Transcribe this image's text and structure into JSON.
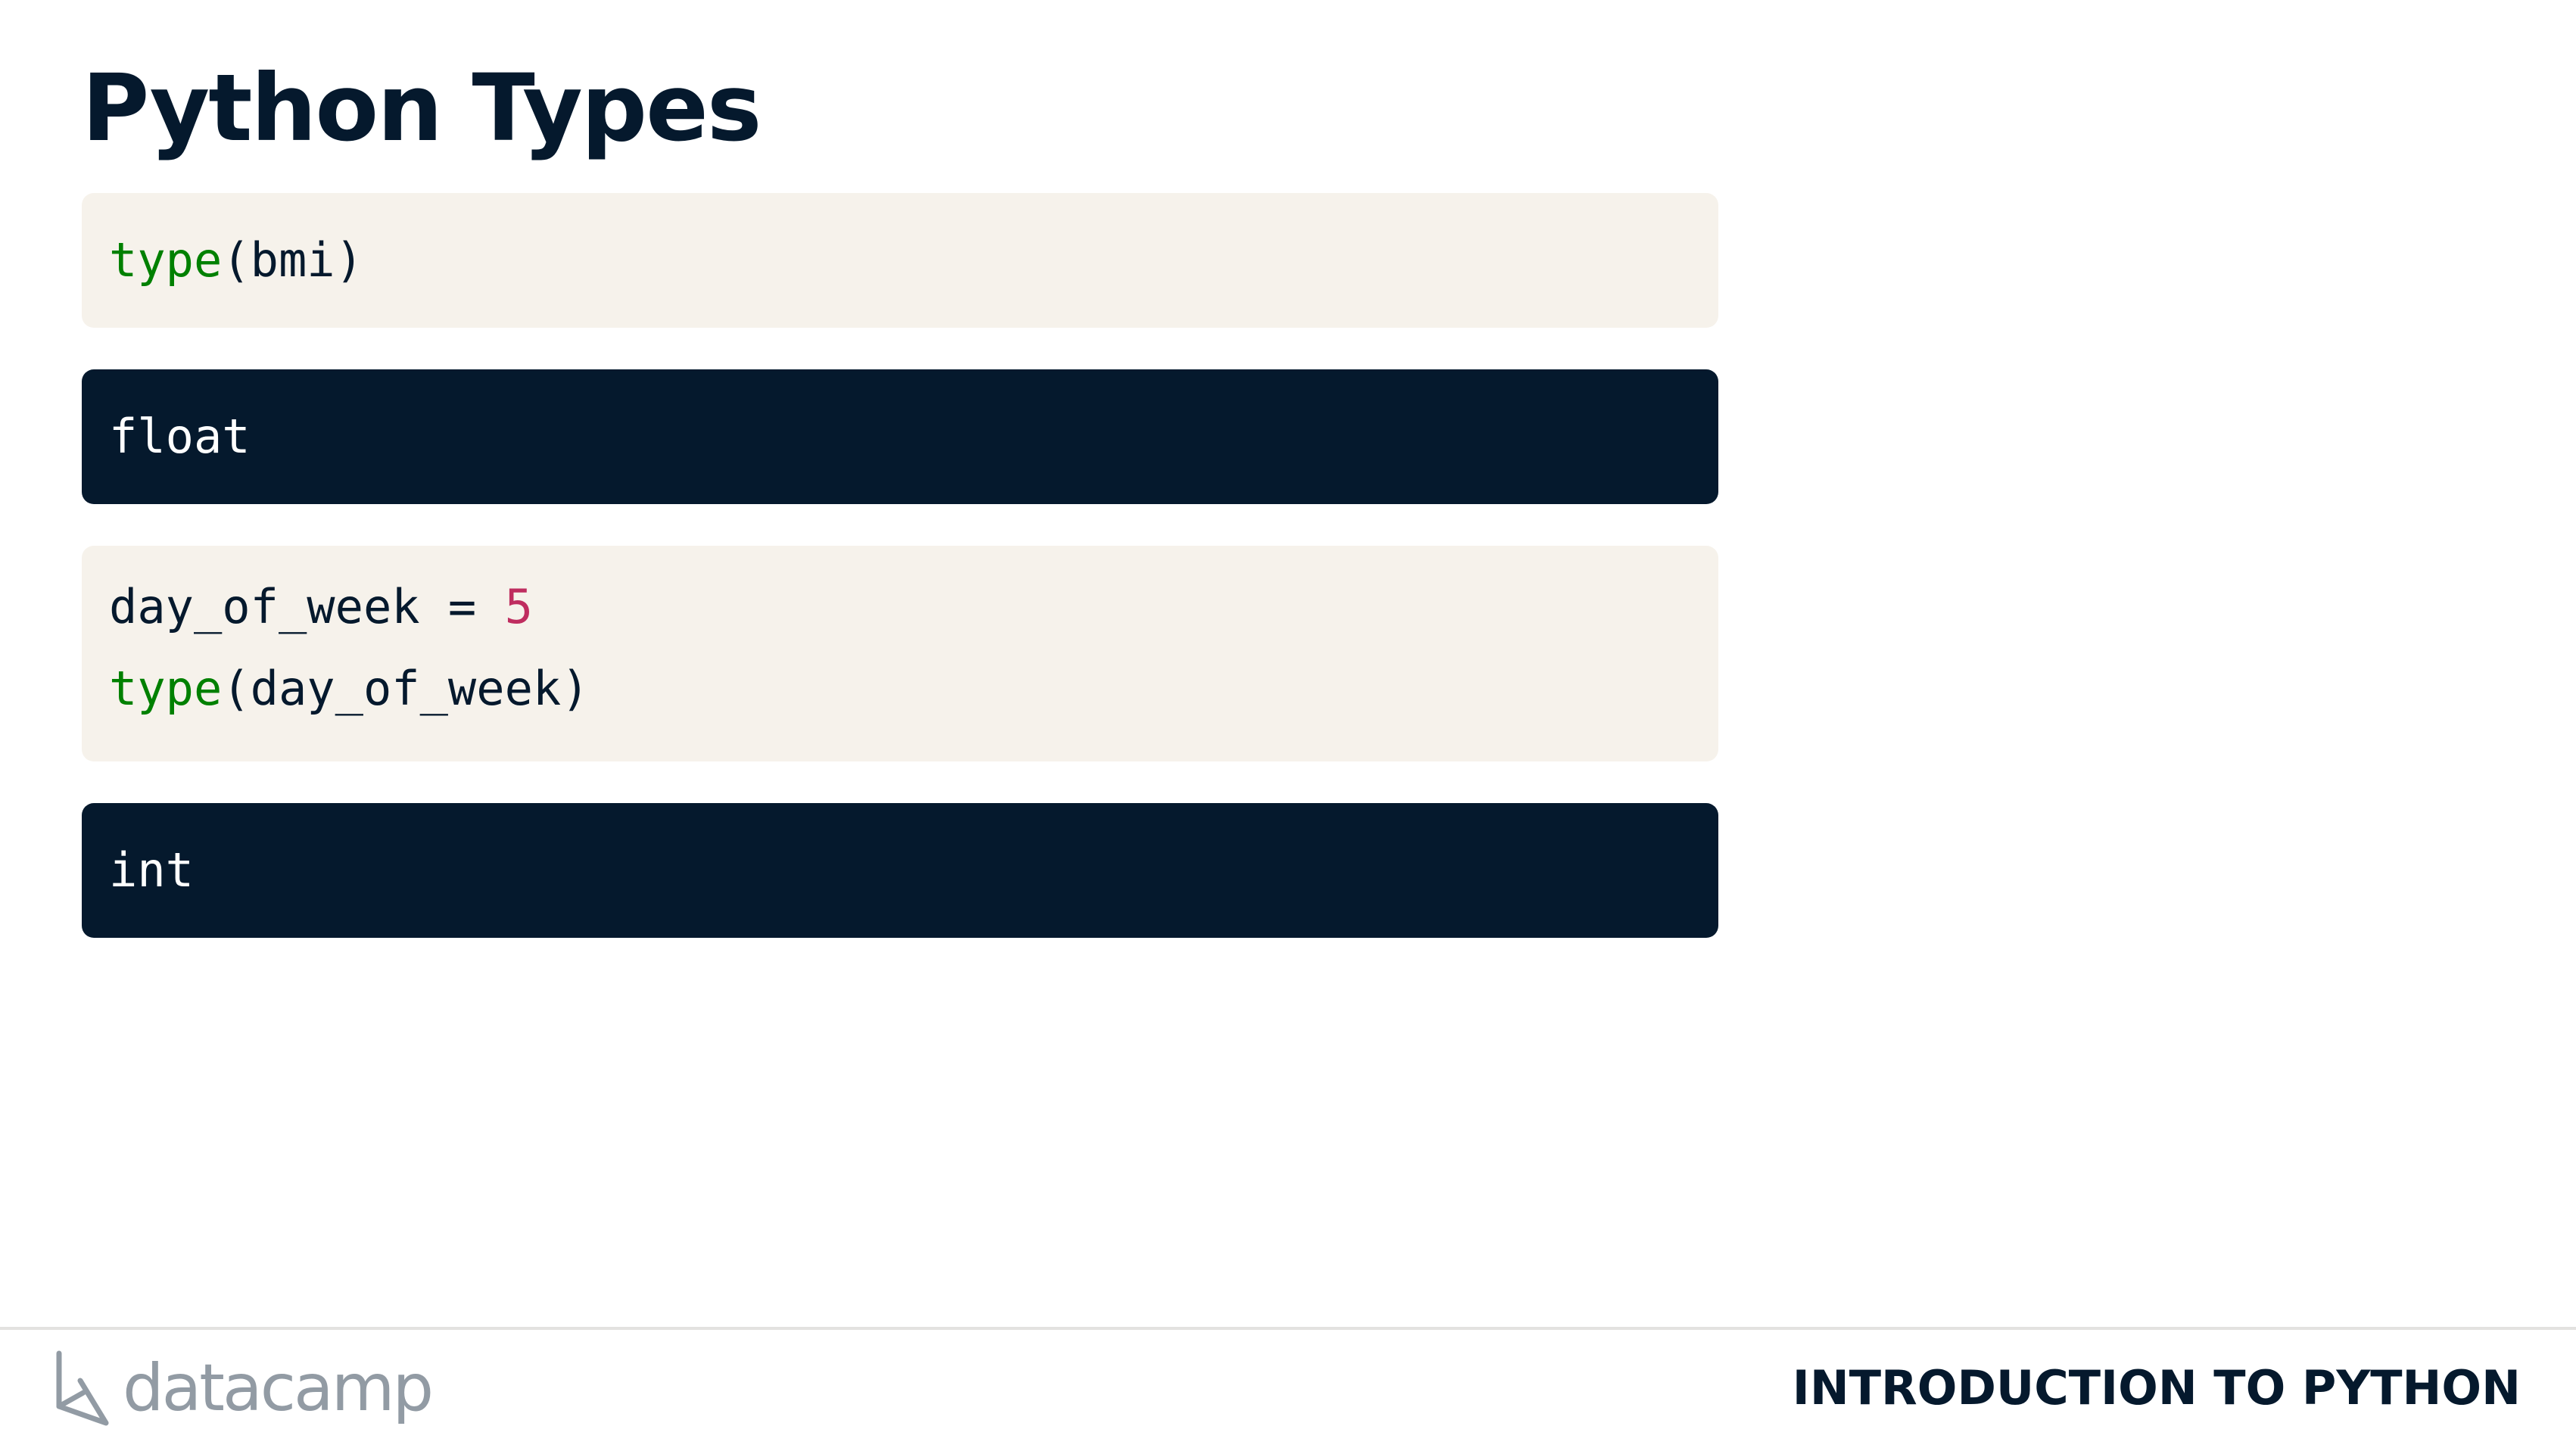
{
  "slide": {
    "title": "Python Types"
  },
  "code_blocks": [
    {
      "kind": "input",
      "lines": [
        {
          "fn": "type",
          "rest": "(bmi)"
        }
      ]
    },
    {
      "kind": "output",
      "lines": [
        {
          "text": "float"
        }
      ]
    },
    {
      "kind": "input",
      "lines": [
        {
          "text": "day_of_week = ",
          "number": "5"
        },
        {
          "fn": "type",
          "rest": "(day_of_week)"
        }
      ]
    },
    {
      "kind": "output",
      "lines": [
        {
          "text": "int"
        }
      ]
    }
  ],
  "footer": {
    "logo_text": "datacamp",
    "logo_icon": "datacamp-logo-icon",
    "course_title": "INTRODUCTION TO PYTHON"
  },
  "colors": {
    "heading": "#05192d",
    "code_input_bg": "#f6f2eb",
    "code_output_bg": "#05192d",
    "keyword_function": "#008000",
    "number_literal": "#bf2d5f",
    "logo_gray": "#929ba4"
  }
}
